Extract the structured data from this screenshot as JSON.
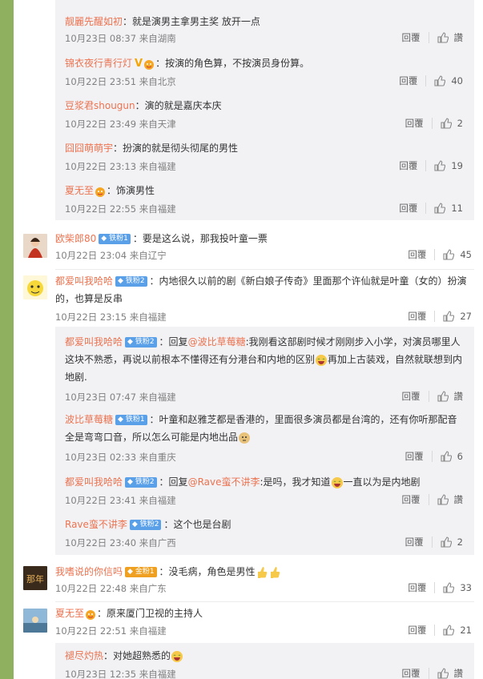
{
  "labels": {
    "reply": "回覆",
    "like": "讚"
  },
  "colors": {
    "username": "#eb7350",
    "sidebar": "#8fb05e",
    "badge": "#5aa0e8"
  },
  "block1": [
    {
      "user": "靓麗先醒如初",
      "sep": "：",
      "text": "就是演男主拿男主奖 放开一点",
      "time": "10月23日 08:37 来自湖南",
      "likes": "讚"
    },
    {
      "user": "锦衣夜行青行灯",
      "sep": "：",
      "text": "按演的角色算，不按演员身份算。",
      "time": "10月22日 23:51 来自北京",
      "likes": "40"
    },
    {
      "user": "豆浆君shougun",
      "sep": "：",
      "text": "演的就是嘉庆本庆",
      "time": "10月22日 23:49 来自天津",
      "likes": "2"
    },
    {
      "user": "囧囧萌萌宇",
      "sep": "：",
      "text": "扮演的就是彻头彻尾的男性",
      "time": "10月22日 23:13 来自福建",
      "likes": "19"
    },
    {
      "user": "夏无至",
      "sep": "：",
      "text": "饰演男性",
      "time": "10月22日 22:55 来自福建",
      "likes": "11"
    }
  ],
  "top1": {
    "user": "欧柴郎80",
    "badge": "铁粉1",
    "text": "：要是这么说，那我投叶童一票",
    "time": "10月22日 23:04 来自辽宁",
    "likes": "45"
  },
  "top2": {
    "user": "都爱叫我哈哈",
    "badge": "铁粉2",
    "text": "：内地很久以前的剧《新白娘子传奇》里面那个许仙就是叶童（女的）扮演的，也算是反串",
    "time": "10月22日 23:15 来自福建",
    "likes": "27"
  },
  "block2": [
    {
      "user": "都爱叫我哈哈",
      "badge": "铁粉2",
      "pre": "：回复",
      "mention": "@波比草莓糖",
      "text": ":我刚看这部剧时候才刚刚步入小学，对演员哪里人这块不熟悉，再说以前根本不懂得还有分港台和内地的区别",
      "text2": "再加上古装戏，自然就联想到内地剧.",
      "time": "10月23日 07:47 来自福建",
      "likes": "讚"
    },
    {
      "user": "波比草莓糖",
      "badge": "铁粉1",
      "text": "：叶童和赵雅芝都是香港的，里面很多演员都是台湾的，还有你听那配音全是弯弯口音，所以怎么可能是内地出品",
      "time": "10月23日 02:33 来自重庆",
      "likes": "6"
    },
    {
      "user": "都爱叫我哈哈",
      "badge": "铁粉2",
      "pre": "：回复",
      "mention": "@Rave蛮不讲李",
      "text": ":是吗，我才知道",
      "text2": "一直以为是内地剧",
      "time": "10月22日 23:41 来自福建",
      "likes": "讚"
    },
    {
      "user": "Rave蛮不讲李",
      "badge": "铁粉2",
      "text": "：这个也是台剧",
      "time": "10月22日 23:40 来自广西",
      "likes": "2"
    }
  ],
  "top3": {
    "user": "我嗜说的你信吗",
    "badge": "金粉1",
    "text": "：没毛病，角色是男性",
    "time": "10月22日 22:48 来自广东",
    "likes": "33"
  },
  "top4": {
    "user": "夏无至",
    "text": "：原来厦门卫视的主持人",
    "time": "10月22日 22:51 来自福建",
    "likes": "21"
  },
  "block3": [
    {
      "user": "褪尽灼热",
      "text": "：对她超熟悉的",
      "time": "10月23日 12:35 来自福建",
      "likes": "讚"
    }
  ]
}
